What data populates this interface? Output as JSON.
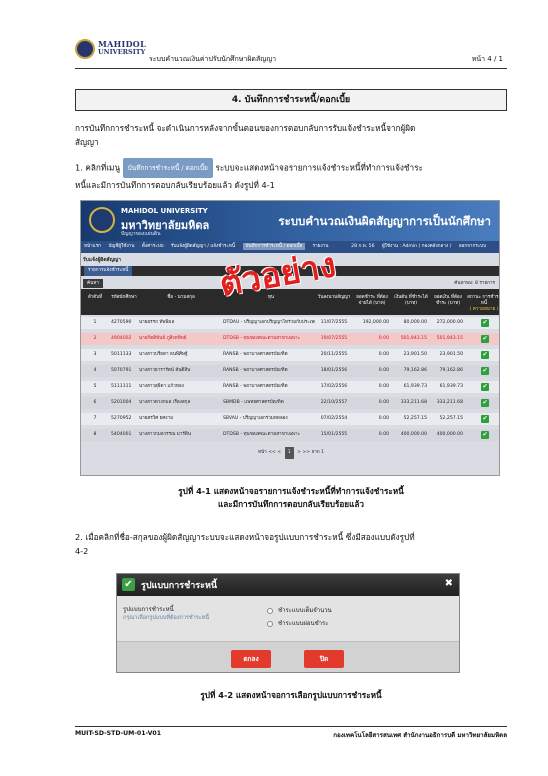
{
  "header": {
    "logo_line1": "MAHIDOL",
    "logo_line2": "UNIVERSITY",
    "doc_title": "ระบบคำนวณเงินค่าปรับนักศึกษาผิดสัญญา",
    "page_label": "หน้า 4 / 1"
  },
  "section": {
    "heading": "4. บันทึกการชำระหนี้/ดอกเบี้ย",
    "intro_line1": "การบันทึกการชำระหนี้ จะดำเนินการหลังจากขั้นตอนของการตอบกลับการรับแจ้งชำระหนี้จากผู้ผิด",
    "intro_line2": "สัญญา",
    "step1_prefix": "1. คลิกที่เมนู",
    "step1_menu_chip": "บันทึกการชำระหนี้ / ดอกเบี้ย",
    "step1_suffix": "ระบบจะแสดงหน้าจอรายการแจ้งชำระหนี้ที่ทำการแจ้งชำระ",
    "step1_line2": "หนี้และมีการบันทึกการตอบกลับเรียบร้อยแล้ว ดังรูปที่ 4-1",
    "fig1_caption_line1": "รูปที่ 4-1 แสดงหน้าจอรายการแจ้งชำระหนี้ที่ทำการแจ้งชำระหนี้",
    "fig1_caption_line2": "และมีการบันทึกการตอบกลับเรียบร้อยแล้ว",
    "step2_line1": "2. เมื่อคลิกที่ชื่อ-สกุลของผู้ผิดสัญญาระบบจะแสดงหน้าจอรูปแบบการชำระหนี้ ซึ่งมีสองแบบดังรูปที่",
    "step2_line2": "4-2",
    "fig2_caption": "รูปที่ 4-2 แสดงหน้าจอการเลือกรูปแบบการชำระหนี้"
  },
  "screenshot1": {
    "uni_name_en": "MAHIDOL UNIVERSITY",
    "uni_name_th": "มหาวิทยาลัยมหิดล",
    "uni_tagline": "ปัญญาของแผ่นดิน",
    "system_title": "ระบบคำนวณเงินผิดสัญญาการเป็นนักศึกษา",
    "nav": {
      "items": [
        "หน้าแรก",
        "บัญชีผู้ใช้งาน",
        "ตั้งค่าระบบ",
        "รับแจ้งผู้ผิดสัญญา / แจ้งชำระหนี้",
        "บันทึกการชำระหนี้ / ดอกเบี้ย",
        "รายงาน"
      ],
      "active_index": 4,
      "date": "28 ก.พ. 56",
      "user": "ผู้ใช้งาน : Admin ( กองคลังกลาง )",
      "logout": "ออกจากระบบ"
    },
    "content_title": "รับแจ้งผู้ผิดสัญญา",
    "sub_tab": "รายการแจ้งชำระหนี้",
    "search_button": "ค้นหา",
    "record_count": "ค้นหาพบ: 8 รายการ",
    "columns": [
      "ลำดับที่",
      "รหัสนักศึกษา",
      "ชื่อ - นามสกุล",
      "ทุน",
      "วันลงนามสัญญา",
      "ยอดชำระ ที่ต้องจ่ายได้ (บาท)",
      "เงินต้น ที่ชำระได้ (บาท)",
      "ยอดเงิน ที่ต้องชำระ (บาท)",
      "สถานะ การชำระหนี้"
    ],
    "status_legend": "( ความหมาย )",
    "rows": [
      {
        "no": "1",
        "id": "4270590",
        "name": "นายอรรถ ทัพพิมล",
        "fund": "DTDAU - ปริญญาเอกปริญญาโทร่วมกับประเทศ",
        "date": "11/07/2555",
        "interest": "192,000.00",
        "principal": "80,000.00",
        "total": "272,000.00",
        "style": "alt"
      },
      {
        "no": "2",
        "id": "4904002",
        "name": "นายกิตติพันธ์ ภูสิงหทิพย์",
        "fund": "DTDSB - ทุนของคณะตามสาขาเฉพาะ",
        "date": "19/07/2555",
        "interest": "0.00",
        "principal": "501,943.15",
        "total": "501,943.15",
        "style": "red"
      },
      {
        "no": "3",
        "id": "5011133",
        "name": "นางสาวปรียดา ธนพิศิษฐ์",
        "fund": "RANSB - พยาบาลศาสตรบัณฑิต",
        "date": "20/11/2555",
        "interest": "0.00",
        "principal": "23,901.50",
        "total": "23,901.50",
        "style": "alt"
      },
      {
        "no": "4",
        "id": "5070791",
        "name": "นางสาวธารารัตน์ สันติสิน",
        "fund": "RANSB - พยาบาลศาสตรบัณฑิต",
        "date": "18/01/2556",
        "interest": "0.00",
        "principal": "79,162.86",
        "total": "79,162.86",
        "style": "norm"
      },
      {
        "no": "5",
        "id": "5111111",
        "name": "นางสาวสุธิดา แก้วทอง",
        "fund": "RANSB - พยาบาลศาสตรบัณฑิต",
        "date": "17/02/2556",
        "interest": "0.00",
        "principal": "61,939.73",
        "total": "61,939.73",
        "style": "alt"
      },
      {
        "no": "6",
        "id": "5201004",
        "name": "นางสาวดวงกมล เรืองสกุล",
        "fund": "SBMDB - แพทยศาสตรบัณฑิต",
        "date": "22/10/2557",
        "interest": "0.00",
        "principal": "333,211.68",
        "total": "333,211.68",
        "style": "norm"
      },
      {
        "no": "7",
        "id": "5270952",
        "name": "นายสรวิศ ยศงาม",
        "fund": "SBVAU - ปริญญาเอกร่วมทดลอง",
        "date": "07/02/2554",
        "interest": "0.00",
        "principal": "52,257.15",
        "total": "52,257.15",
        "style": "alt"
      },
      {
        "no": "8",
        "id": "5404001",
        "name": "นางสาวกมลวรรณ มาร์ติน",
        "fund": "DTDSB - ทุนของคณะตามสาขาเฉพาะ",
        "date": "15/01/2555",
        "interest": "0.00",
        "principal": "400,000.00",
        "total": "400,000.00",
        "style": "norm"
      }
    ],
    "pager": {
      "prefix": "หน้า",
      "first": "<<",
      "prev": "<",
      "current": "1",
      "next": ">",
      "last": ">>",
      "suffix": "จาก 1"
    },
    "stamp_text": "ตัวอย่าง"
  },
  "dialog": {
    "title": "รูปแบบการชำระหนี้",
    "close_glyph": "✖",
    "field_label": "รูปแบบการชำระหนี้",
    "field_hint": "กรุณาเลือกรูปแบบที่ต้องการชำระหนี้",
    "options": [
      "ชำระแบบเต็มจำนวน",
      "ชำระแบบผ่อนชำระ"
    ],
    "ok_button": "ตกลง",
    "close_button": "ปิด"
  },
  "footer": {
    "doc_code": "MUIT-SD-STD-UM-01-V01",
    "org": "กองเทคโนโลยีสารสนเทศ สำนักงานอธิการบดี มหาวิทยาลัยมหิดล"
  },
  "colors": {
    "banner_blue": "#2f5d9c",
    "stamp_red": "#e21f1f",
    "status_green": "#2e9e3e",
    "dialog_button_red": "#e33a2e"
  }
}
